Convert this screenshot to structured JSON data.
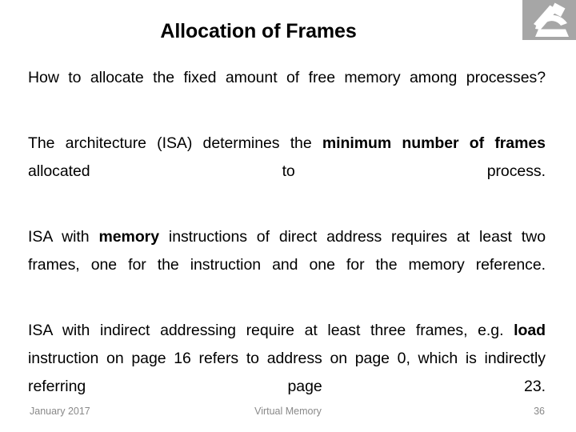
{
  "slide": {
    "title": "Allocation of Frames",
    "logo": {
      "icon": "microscope-icon",
      "background_color": "#a6a6a6",
      "glyph_color": "#ffffff"
    },
    "body_paragraphs": [
      {
        "id": "p1",
        "runs": [
          {
            "text": "How to allocate the fixed amount of free memory among processes?",
            "bold": false
          }
        ]
      },
      {
        "id": "p2",
        "runs": [
          {
            "text": "The architecture (ISA) determines the ",
            "bold": false
          },
          {
            "text": "minimum number of frames",
            "bold": true
          },
          {
            "text": " allocated to process.",
            "bold": false
          }
        ]
      },
      {
        "id": "p3",
        "runs": [
          {
            "text": "ISA with ",
            "bold": false
          },
          {
            "text": "memory",
            "bold": true
          },
          {
            "text": " instructions of direct address requires at least two frames, one for the instruction and one for the memory reference.",
            "bold": false
          }
        ]
      },
      {
        "id": "p4",
        "runs": [
          {
            "text": "ISA with indirect addressing require at least three frames, e.g. ",
            "bold": false
          },
          {
            "text": "load",
            "bold": true
          },
          {
            "text": " instruction on page 16 refers to address on page 0, which is indirectly referring page 23.",
            "bold": false
          }
        ]
      }
    ],
    "footer": {
      "date": "January 2017",
      "center_title": "Virtual Memory",
      "page_number": "36",
      "text_color": "#898989"
    },
    "colors": {
      "background": "#ffffff",
      "text": "#000000",
      "logo_gray": "#a6a6a6",
      "footer_gray": "#898989"
    }
  }
}
